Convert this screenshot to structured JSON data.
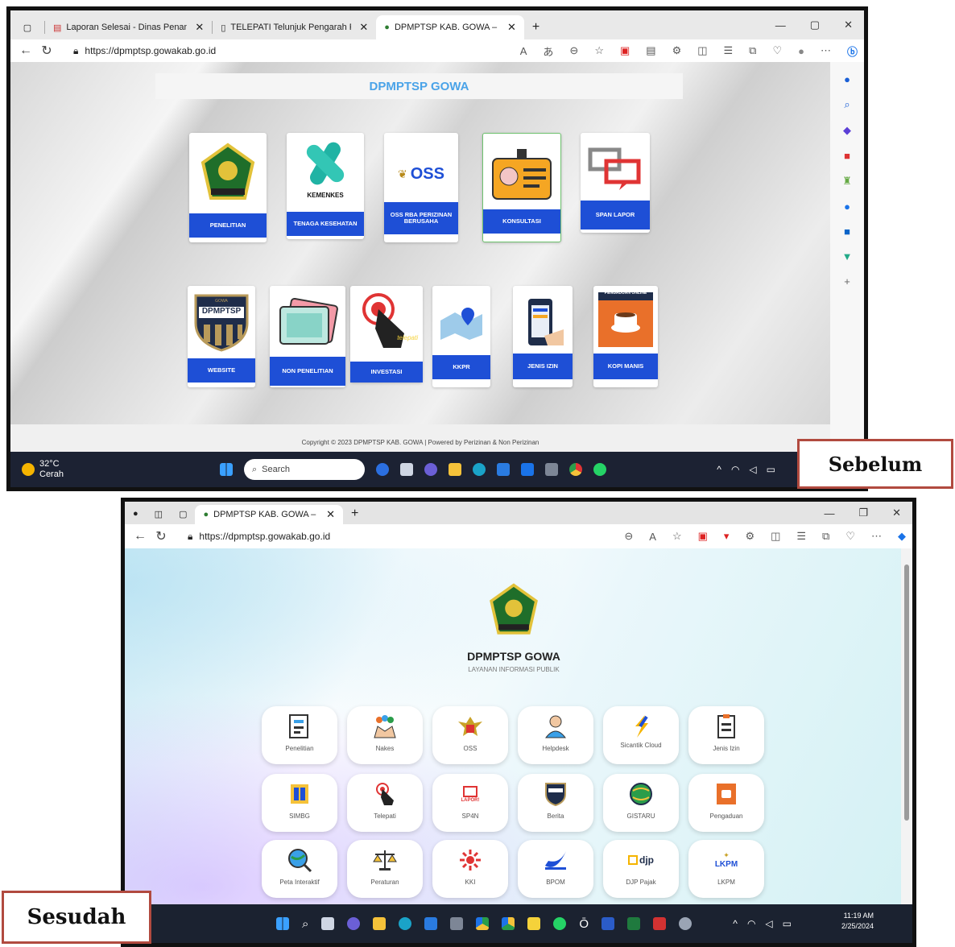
{
  "before": {
    "tabs": [
      {
        "label": "Laporan Selesai - Dinas Penanam"
      },
      {
        "label": "TELEPATI Telunjuk Pengarah Peta"
      },
      {
        "label": "DPMPTSP KAB. GOWA – Dinas P"
      }
    ],
    "url": "https://dpmptsp.gowakab.go.id",
    "banner": "DPMPTSP GOWA",
    "cards": [
      {
        "label": "PENELITIAN"
      },
      {
        "label": "TENAGA KESEHATAN",
        "logo_text": "KEMENKES"
      },
      {
        "label": "OSS RBA PERIZINAN BERUSAHA",
        "logo_text": "OSS"
      },
      {
        "label": "KONSULTASI"
      },
      {
        "label": "SPAN LAPOR"
      },
      {
        "label": "WEBSITE",
        "logo_text": "DPMPTSP",
        "logo_top": "GOWA"
      },
      {
        "label": "NON PENELITIAN"
      },
      {
        "label": "INVESTASI",
        "logo_text": "telepati"
      },
      {
        "label": "KKPR"
      },
      {
        "label": "JENIS IZIN"
      },
      {
        "label": "KOPI MANIS",
        "logo_text": "PENGADUAN ONLINE"
      }
    ],
    "footer": "Copyright © 2023 DPMPTSP KAB. GOWA | Powered by Perizinan & Non Perizinan",
    "weather": {
      "temp": "32°C",
      "cond": "Cerah"
    },
    "search_placeholder": "Search",
    "tag": "Sebelum"
  },
  "after": {
    "tab": "DPMPTSP KAB. GOWA – Dinas P",
    "url": "https://dpmptsp.gowakab.go.id",
    "title": "DPMPTSP GOWA",
    "subtitle": "LAYANAN INFORMASI PUBLIK",
    "tiles": [
      {
        "label": "Penelitian"
      },
      {
        "label": "Nakes"
      },
      {
        "label": "OSS"
      },
      {
        "label": "Helpdesk"
      },
      {
        "label": "Sicantik Cloud"
      },
      {
        "label": "Jenis Izin"
      },
      {
        "label": "SIMBG"
      },
      {
        "label": "Telepati"
      },
      {
        "label": "SP4N",
        "logo_text": "LAPOR!"
      },
      {
        "label": "Berita"
      },
      {
        "label": "GISTARU"
      },
      {
        "label": "Pengaduan"
      },
      {
        "label": "Peta Interaktif"
      },
      {
        "label": "Peraturan"
      },
      {
        "label": "KKI"
      },
      {
        "label": "BPOM"
      },
      {
        "label": "DJP Pajak",
        "logo_text": "djp"
      },
      {
        "label": "LKPM",
        "logo_text": "LKPM"
      }
    ],
    "clock": {
      "time": "11:19 AM",
      "date": "2/25/2024"
    },
    "tag": "Sesudah"
  },
  "colors": {
    "card_label": "#1e4fd6",
    "banner_text": "#4aa3e8",
    "tag_border": "#b14a3f"
  }
}
